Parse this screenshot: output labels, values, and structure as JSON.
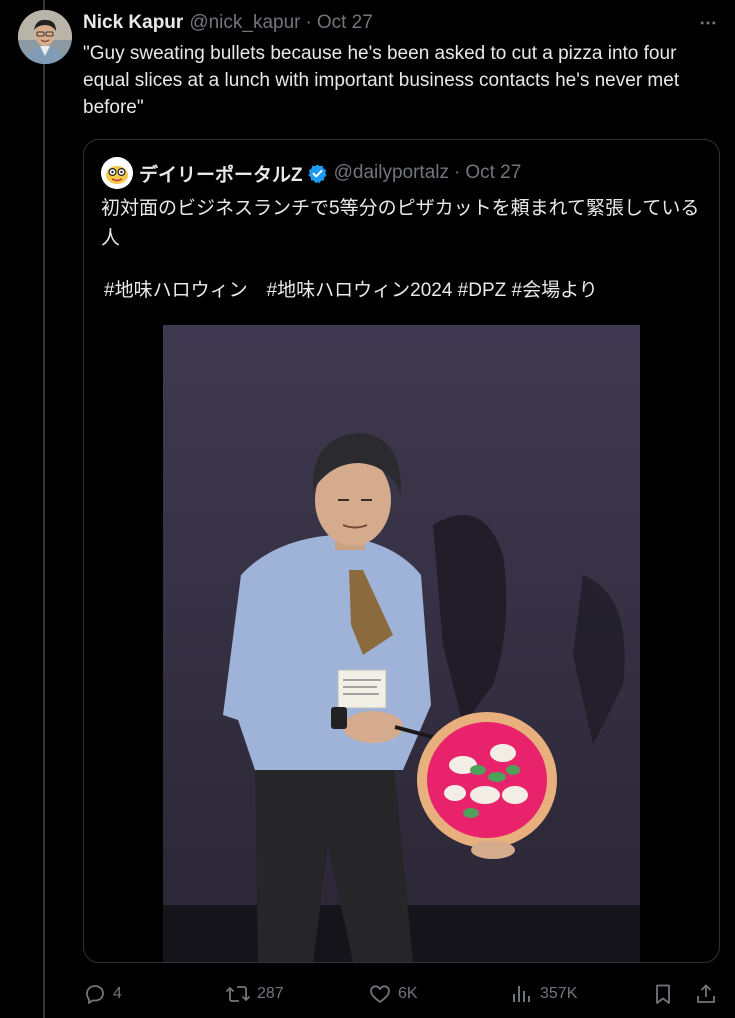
{
  "tweet": {
    "display_name": "Nick Kapur",
    "handle": "@nick_kapur",
    "separator": "·",
    "date": "Oct 27",
    "more_icon": "more-icon",
    "text": "\"Guy sweating bullets because he's been asked to cut a pizza into four equal slices at a lunch with important business contacts he's never met before\""
  },
  "quote": {
    "display_name": "デイリーポータルZ",
    "handle": "@dailyportalz",
    "separator": "·",
    "date": "Oct 27",
    "verified_icon": "verified-badge-icon",
    "text": "初対面のビジネスランチで5等分のピザカットを頼まれて緊張している人",
    "hashtags": "#地味ハロウィン　#地味ハロウィン2024 #DPZ #会場より"
  },
  "actions": {
    "replies": "4",
    "reposts": "287",
    "likes": "6K",
    "views": "357K"
  },
  "colors": {
    "background": "#000000",
    "text": "#e7e9ea",
    "muted": "#71767b",
    "border": "#2f3336",
    "verified": "#1d9bf0"
  }
}
